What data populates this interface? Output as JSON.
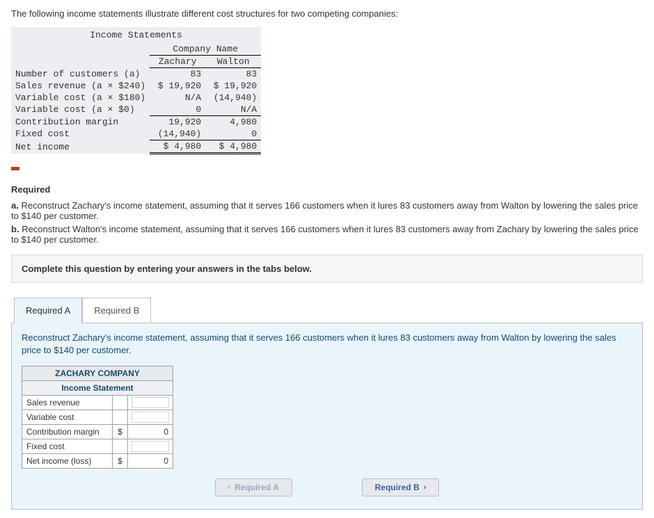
{
  "intro": "The following income statements illustrate different cost structures for two competing companies:",
  "income_statements": {
    "title": "Income Statements",
    "company_header": "Company Name",
    "companies": [
      "Zachary",
      "Walton"
    ],
    "rows": [
      {
        "label": "Number of customers (a)",
        "z": "83",
        "w": "83"
      },
      {
        "label": "Sales revenue (a × $240)",
        "z": "$ 19,920",
        "w": "$ 19,920"
      },
      {
        "label": "Variable cost (a × $180)",
        "z": "N/A",
        "w": "(14,940)"
      },
      {
        "label": "Variable cost (a × $0)",
        "z": "0",
        "w": "N/A"
      },
      {
        "label": "Contribution margin",
        "z": "19,920",
        "w": "4,980"
      },
      {
        "label": "Fixed cost",
        "z": "(14,940)",
        "w": "0"
      },
      {
        "label": "Net income",
        "z": "$  4,980",
        "w": "$  4,980"
      }
    ]
  },
  "required_heading": "Required",
  "requirements": {
    "a": {
      "label": "a.",
      "text": "Reconstruct Zachary's income statement, assuming that it serves 166 customers when it lures 83 customers away from Walton by lowering the sales price to $140 per customer."
    },
    "b": {
      "label": "b.",
      "text": "Reconstruct Walton's income statement, assuming that it serves 166 customers when it lures 83 customers away from Zachary by lowering the sales price to $140 per customer."
    }
  },
  "instruction": "Complete this question by entering your answers in the tabs below.",
  "tabs": {
    "a": "Required A",
    "b": "Required B"
  },
  "panel_text": "Reconstruct Zachary's income statement, assuming that it serves 166 customers when it lures 83 customers away from Walton by lowering the sales price to $140 per customer.",
  "answer_table": {
    "company": "ZACHARY COMPANY",
    "stmt": "Income Statement",
    "rows": [
      {
        "label": "Sales revenue",
        "currency": "",
        "amount": ""
      },
      {
        "label": "Variable cost",
        "currency": "",
        "amount": ""
      },
      {
        "label": "Contribution margin",
        "currency": "$",
        "amount": "0"
      },
      {
        "label": "Fixed cost",
        "currency": "",
        "amount": ""
      },
      {
        "label": "Net income (loss)",
        "currency": "$",
        "amount": "0"
      }
    ]
  },
  "navprev": "Required A",
  "navnext": "Required B"
}
